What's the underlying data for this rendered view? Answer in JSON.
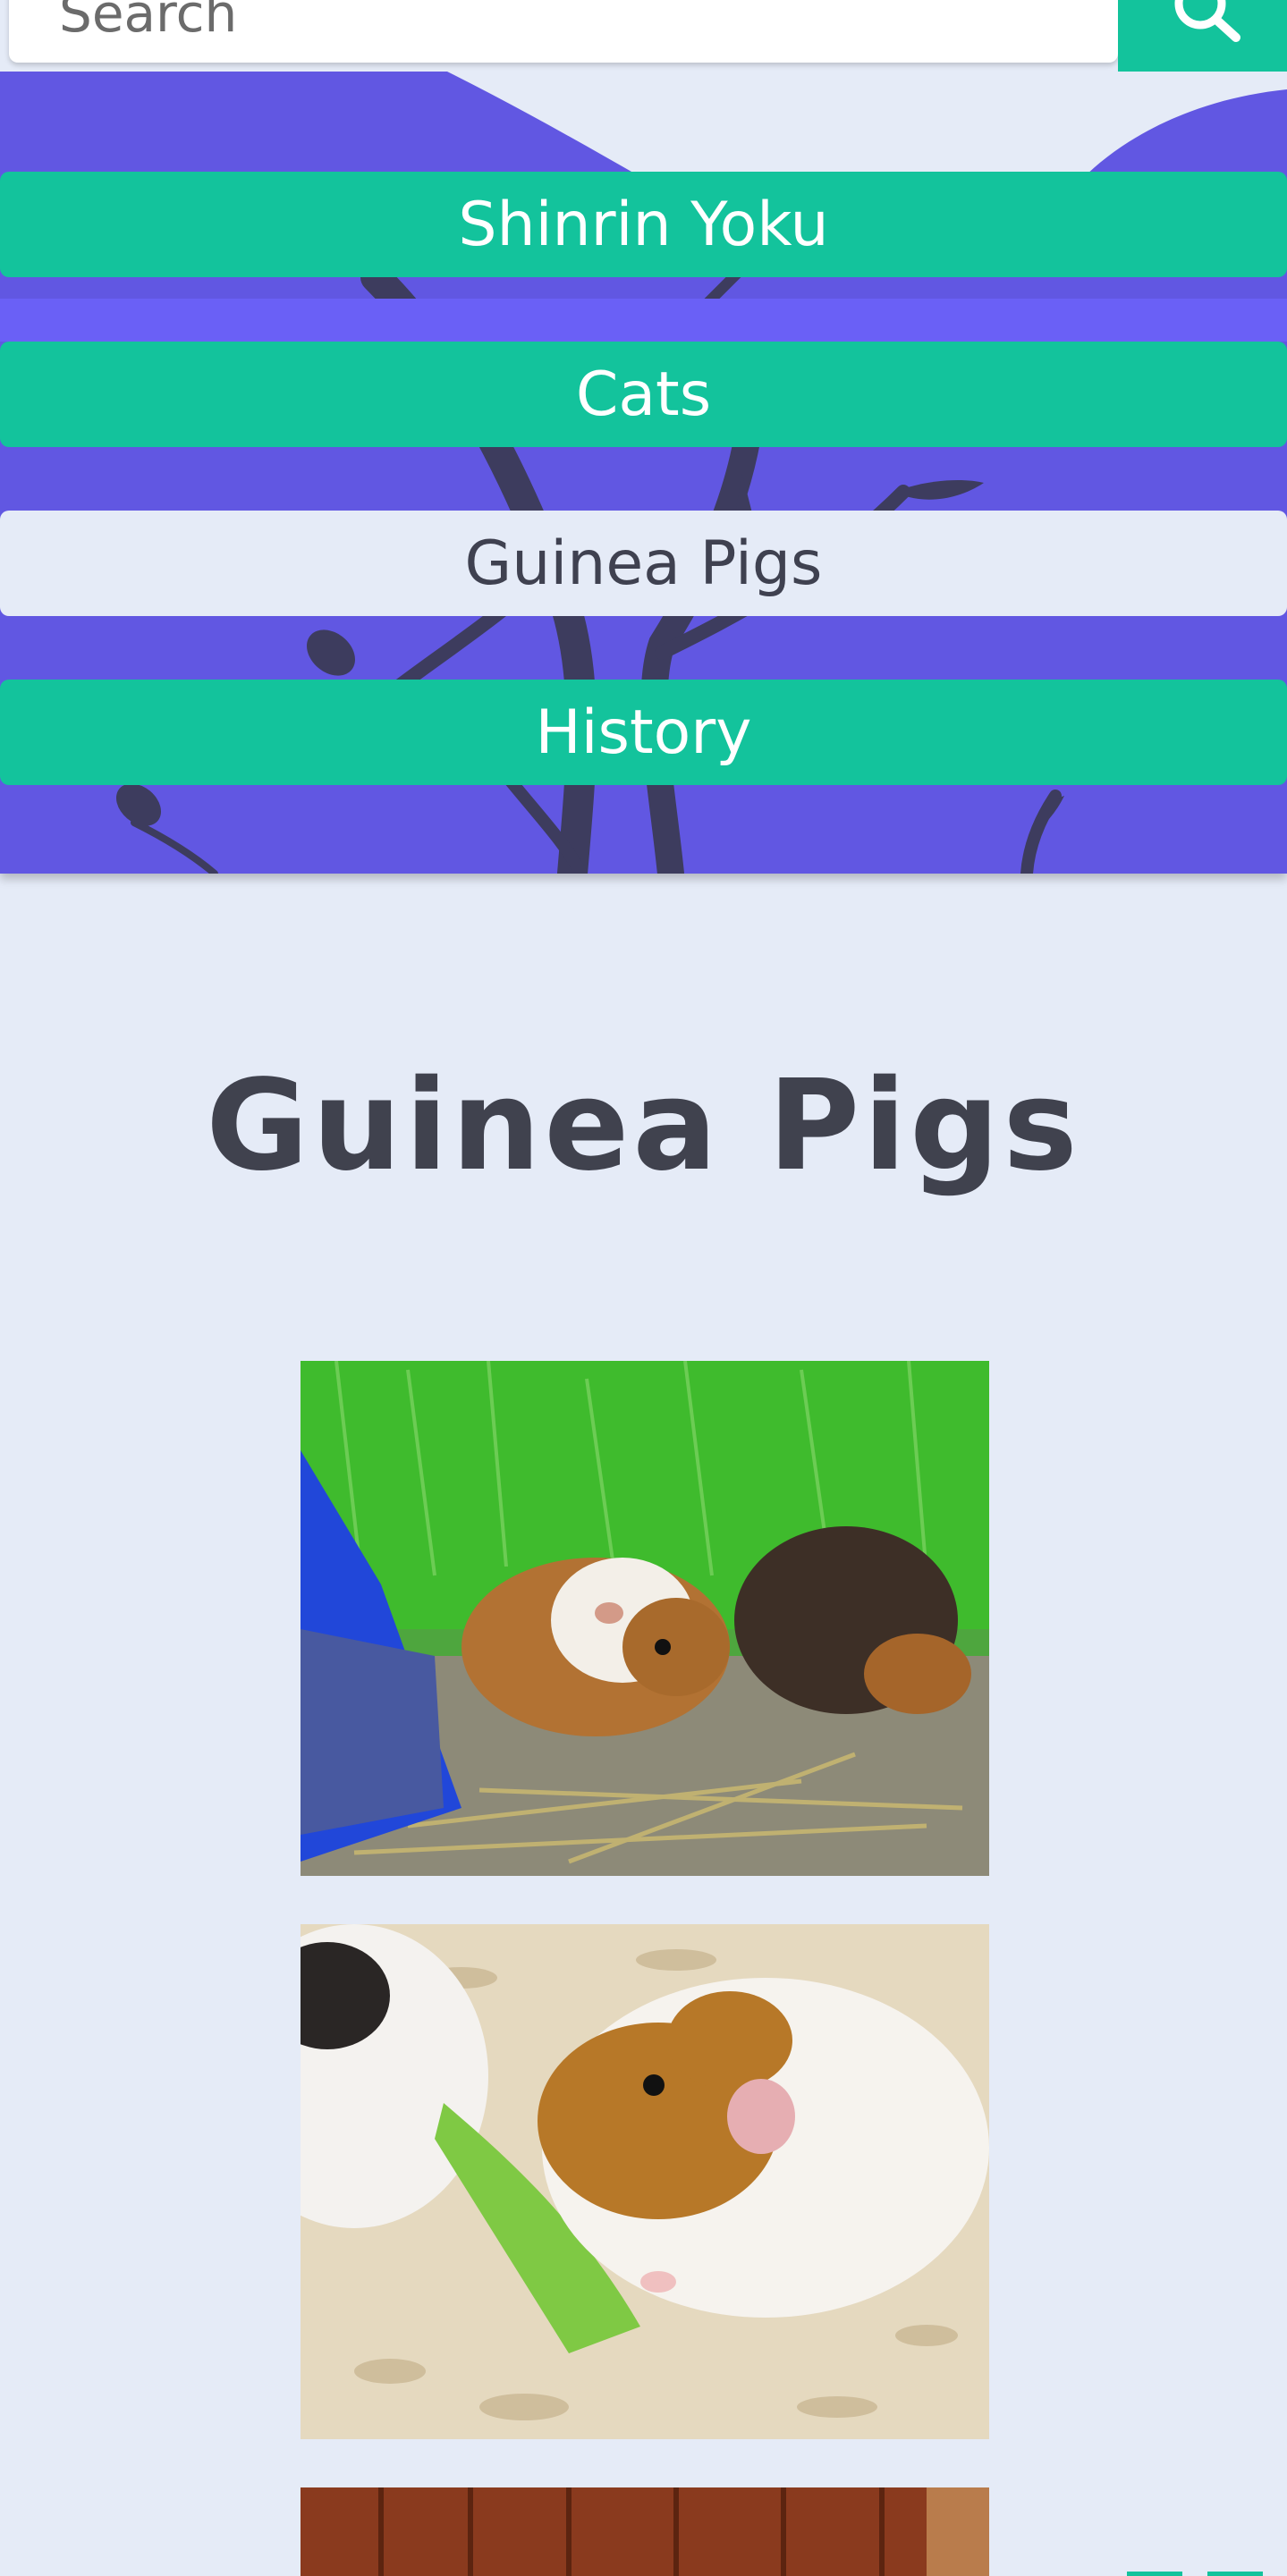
{
  "search": {
    "placeholder": "Search",
    "button_icon": "search-icon"
  },
  "nav": {
    "items": [
      {
        "label": "Shinrin Yoku",
        "active": false
      },
      {
        "label": "Cats",
        "active": false
      },
      {
        "label": "Guinea Pigs",
        "active": true
      },
      {
        "label": "History",
        "active": false
      }
    ]
  },
  "main": {
    "title": "Guinea Pigs",
    "photos": [
      {
        "description": "two guinea pigs on hay and grass"
      },
      {
        "description": "guinea pig eating lettuce on wood shavings"
      },
      {
        "description": "guinea pig photo partially visible"
      }
    ]
  },
  "colors": {
    "accent": "#13c39c",
    "nav_bg": "#6157e2",
    "page_bg": "#e5ebf7",
    "text_dark": "#40424e"
  }
}
